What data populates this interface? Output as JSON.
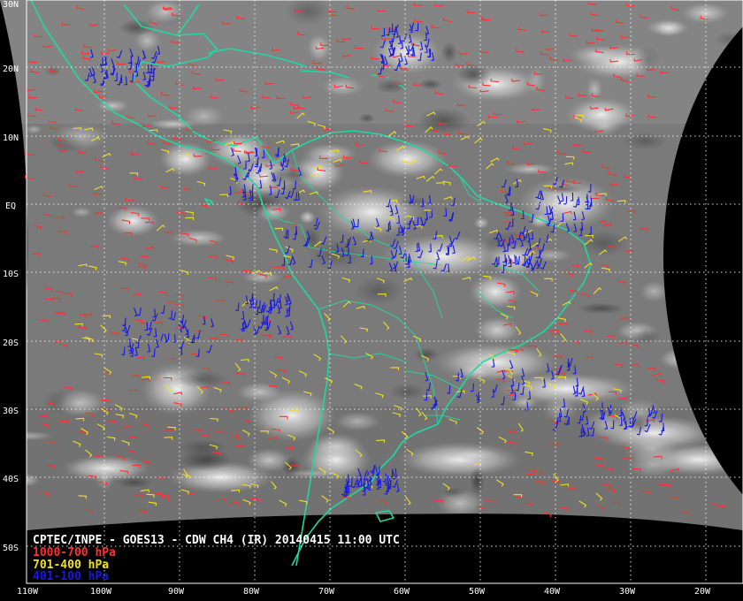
{
  "title": "CPTEC/INPE - GOES13 - CDW CH4 (IR) 20140415 11:00 UTC",
  "legend": [
    {
      "label": "1000-700 hPa",
      "color": "#ff3030"
    },
    {
      "label": "701-400 hPa",
      "color": "#f0e020"
    },
    {
      "label": "401-100 hPa",
      "color": "#1818e0"
    }
  ],
  "lat_labels": [
    "30N",
    "20N",
    "10N",
    "EQ",
    "10S",
    "20S",
    "30S",
    "40S",
    "50S"
  ],
  "lon_labels": [
    "110W",
    "100W",
    "90W",
    "80W",
    "70W",
    "60W",
    "50W",
    "40W",
    "30W",
    "20W"
  ],
  "colors": {
    "coast": "#20d8a0",
    "grid": "#ffffff",
    "background": "#000000"
  }
}
